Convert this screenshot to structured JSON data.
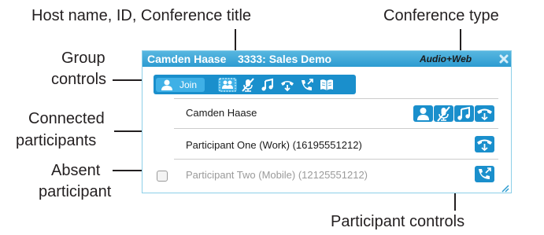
{
  "callouts": {
    "host_line": "Host name, ID, Conference title",
    "conference_type": "Conference type",
    "group_controls_1": "Group",
    "group_controls_2": "controls",
    "connected_1": "Connected",
    "connected_2": "participants",
    "absent_1": "Absent",
    "absent_2": "participant",
    "participant_controls": "Participant controls"
  },
  "titlebar": {
    "host_name": "Camden Haase",
    "conference": "3333: Sales Demo",
    "type": "Audio+Web"
  },
  "group_bar": {
    "join_label": "Join"
  },
  "participants": [
    {
      "name": "Camden Haase"
    },
    {
      "name": "Participant One (Work) (16195551212)"
    },
    {
      "name": "Participant Two (Mobile) (12125551212)"
    }
  ],
  "colors": {
    "title_bar": "#2c9bd1",
    "button": "#1a8fcc",
    "button_light": "#3fb0e6",
    "absent_text": "#9a9a9a"
  },
  "icons": {
    "close": "close-icon",
    "person": "person-icon",
    "group_select": "group-select-icon",
    "mute": "mute-icon",
    "music": "music-icon",
    "hangup": "hangup-icon",
    "dial": "dial-out-icon",
    "book": "book-icon"
  }
}
